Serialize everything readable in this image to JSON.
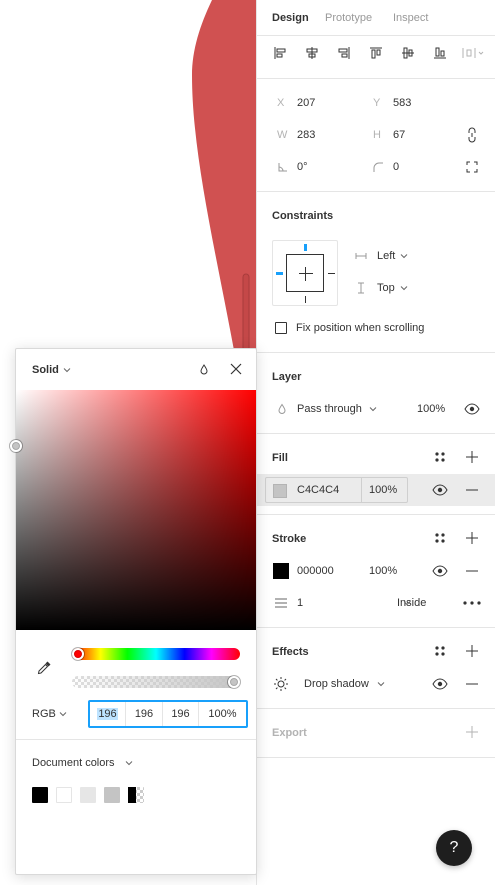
{
  "canvas": {
    "shape_color": "#d05151"
  },
  "tabs": [
    {
      "label": "Design",
      "active": true
    },
    {
      "label": "Prototype",
      "active": false
    },
    {
      "label": "Inspect",
      "active": false
    }
  ],
  "alignment": {
    "icons": [
      "align-left-icon",
      "align-horizontal-center-icon",
      "align-right-icon",
      "align-top-icon",
      "align-vertical-center-icon",
      "align-bottom-icon",
      "distribute-icon"
    ]
  },
  "transform": {
    "x_label": "X",
    "x_value": "207",
    "y_label": "Y",
    "y_value": "583",
    "w_label": "W",
    "w_value": "283",
    "h_label": "H",
    "h_value": "67",
    "rotation_value": "0°",
    "radius_value": "0"
  },
  "constraints": {
    "title": "Constraints",
    "horizontal": "Left",
    "vertical": "Top",
    "fix_position_label": "Fix position when scrolling"
  },
  "layer": {
    "title": "Layer",
    "blend_mode": "Pass through",
    "opacity": "100%"
  },
  "fill": {
    "title": "Fill",
    "hex": "C4C4C4",
    "opacity": "100%",
    "color": "#c4c4c4"
  },
  "stroke": {
    "title": "Stroke",
    "hex": "000000",
    "opacity": "100%",
    "color": "#000000",
    "weight": "1",
    "position": "Inside"
  },
  "effects": {
    "title": "Effects",
    "effect": "Drop shadow"
  },
  "export": {
    "title": "Export"
  },
  "color_picker": {
    "mode": "Solid",
    "hue_position": 0,
    "alpha_position": 1,
    "format": "RGB",
    "r": "196",
    "g": "196",
    "b": "196",
    "a": "100%",
    "document_colors_label": "Document colors",
    "document_colors": [
      "#000000",
      "#ffffff",
      "#e6e6e6",
      "#c4c4c4",
      "#000000"
    ]
  },
  "help": {
    "label": "?"
  }
}
